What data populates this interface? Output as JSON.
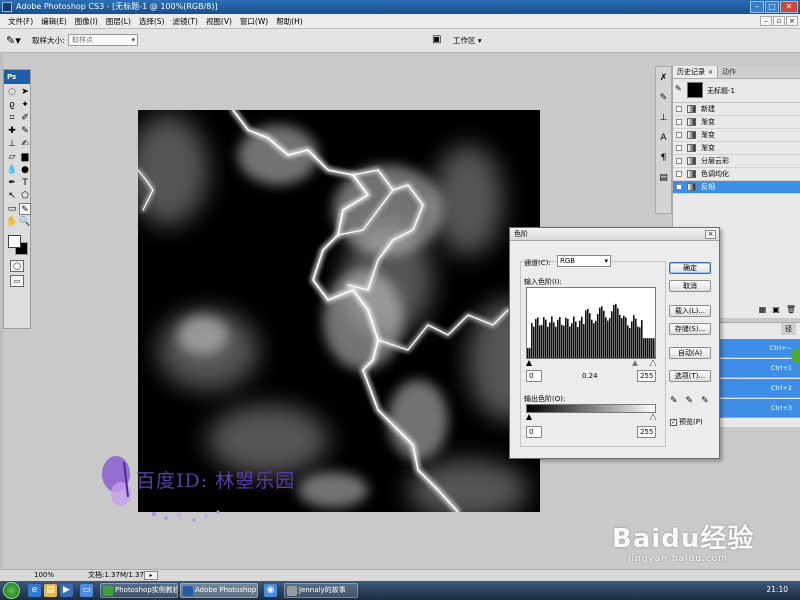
{
  "window": {
    "title": "Adobe Photoshop CS3 - [无标题-1 @ 100%(RGB/8)]"
  },
  "menu": [
    "文件(F)",
    "编辑(E)",
    "图像(I)",
    "图层(L)",
    "选择(S)",
    "滤镜(T)",
    "视图(V)",
    "窗口(W)",
    "帮助(H)"
  ],
  "options": {
    "sample_size_label": "取样大小:",
    "sample_size_value": "取样点",
    "workspace_label": "工作区"
  },
  "toolbox": {
    "logo": "Ps"
  },
  "history_panel": {
    "tabs": [
      "历史记录",
      "动作"
    ],
    "snapshot_label": "无标题-1",
    "rows": [
      "新建",
      "渐变",
      "渐变",
      "渐变",
      "分层云彩",
      "色调均化",
      "反相"
    ],
    "selected_index": 6
  },
  "shortcuts": [
    "Ctrl+~",
    "Ctrl+1",
    "Ctrl+2",
    "Ctrl+3"
  ],
  "levels_dialog": {
    "title": "色阶",
    "channel_label": "通道(C):",
    "channel_value": "RGB",
    "input_label": "输入色阶(I):",
    "input_black": "0",
    "input_gamma": "0.24",
    "input_white": "255",
    "output_label": "输出色阶(O):",
    "output_black": "0",
    "output_white": "255",
    "buttons": {
      "ok": "确定",
      "cancel": "取消",
      "load": "载入(L)...",
      "save": "存储(S)...",
      "auto": "自动(A)",
      "options": "选项(T)..."
    },
    "preview_label": "预览(P)",
    "preview_checked": true
  },
  "status": {
    "zoom": "100%",
    "doc_info": "文档:1.37M/1.37M"
  },
  "taskbar": {
    "items": [
      "Photoshop实例教程...",
      "Adobe Photoshop ...",
      "Jennaly的故事"
    ],
    "active_index": 1,
    "clock": "21:10"
  },
  "watermarks": {
    "author": "百度ID: 林曌乐园",
    "baidu_logo": "Baidu经验",
    "baidu_site": "jingyan.baidu.com"
  }
}
